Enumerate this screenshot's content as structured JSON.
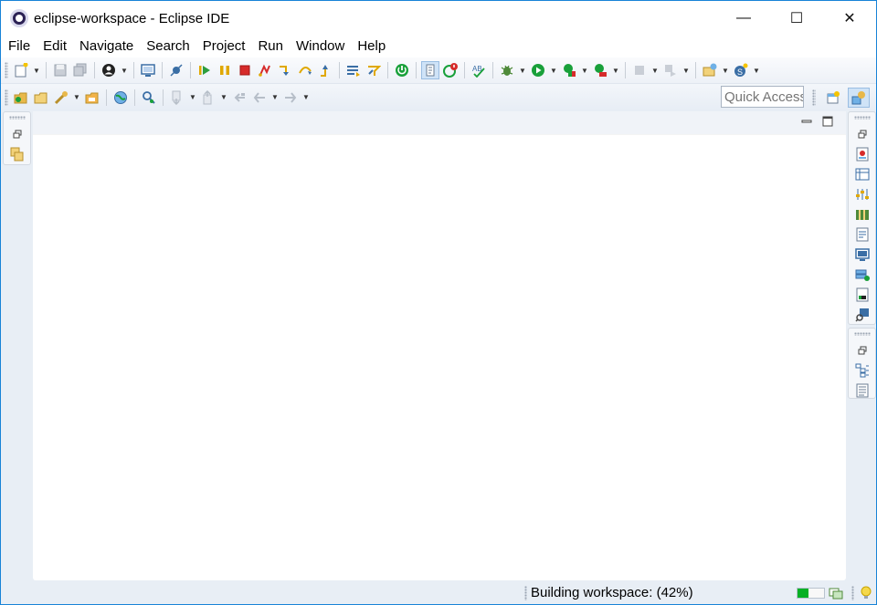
{
  "window": {
    "title": "eclipse-workspace - Eclipse IDE",
    "minimize_glyph": "—",
    "maximize_glyph": "☐",
    "close_glyph": "✕"
  },
  "menu": [
    "File",
    "Edit",
    "Navigate",
    "Search",
    "Project",
    "Run",
    "Window",
    "Help"
  ],
  "toolbar": {
    "quick_access_placeholder": "Quick Access",
    "accent_colors": {
      "resume": "#2e9e3e",
      "suspend": "#e0a800",
      "terminate": "#d62b2b",
      "run": "#19a03a"
    }
  },
  "status": {
    "message": "Building workspace: (42%)",
    "progress_fraction": 0.42
  },
  "icons": {
    "new": "new-wizard-icon",
    "save": "save-icon",
    "save_all": "save-all-icon",
    "debug": "debug-icon",
    "run": "run-icon",
    "quick_access": "quick-access-field",
    "perspective_open": "open-perspective-icon",
    "perspective_java": "java-perspective-icon"
  }
}
